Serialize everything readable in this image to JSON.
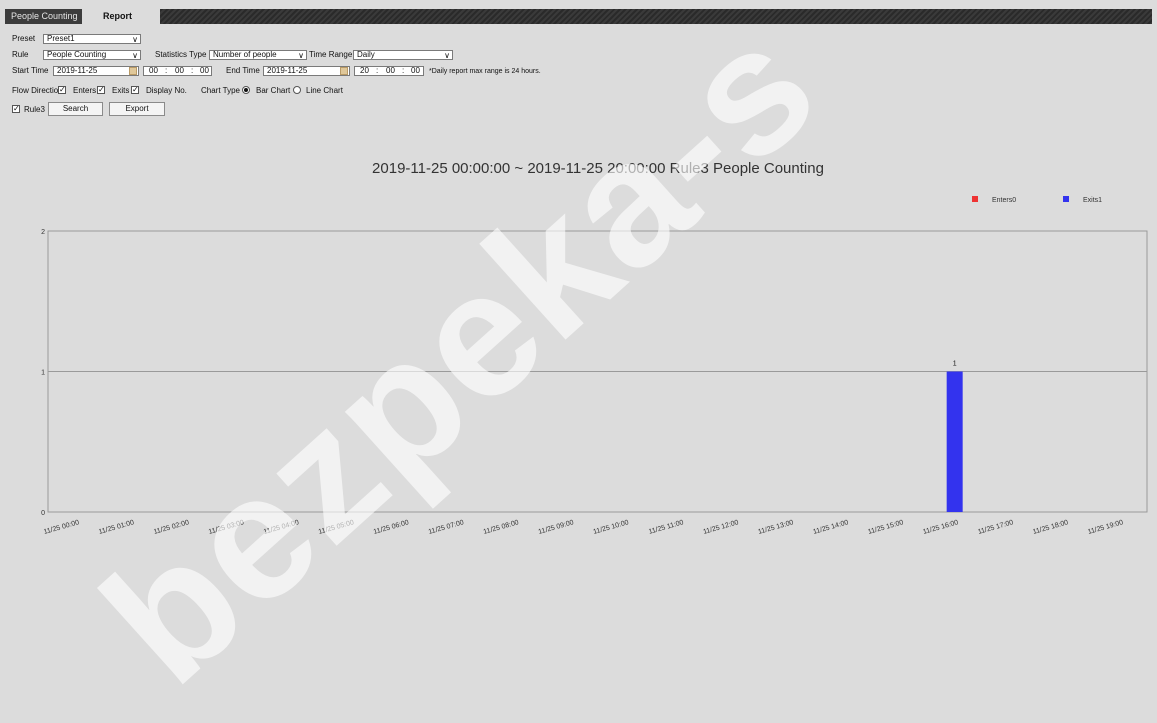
{
  "tabs": [
    {
      "label": "People Counting",
      "active": false
    },
    {
      "label": "Report",
      "active": true
    }
  ],
  "form": {
    "preset_label": "Preset",
    "preset_value": "Preset1",
    "rule_label": "Rule",
    "rule_value": "People Counting",
    "stats_type_label": "Statistics Type",
    "stats_type_value": "Number of people",
    "time_range_label": "Time Range",
    "time_range_value": "Daily",
    "start_time_label": "Start Time",
    "start_date": "2019-11-25",
    "start_hh": "00",
    "start_mm": "00",
    "start_ss": "00",
    "end_time_label": "End Time",
    "end_date": "2019-11-25",
    "end_hh": "20",
    "end_mm": "00",
    "end_ss": "00",
    "time_sep": ":",
    "range_note": "*Daily report max range is 24 hours.",
    "flow_direction_label": "Flow Direction",
    "enters_label": "Enters",
    "enters_checked": true,
    "exits_label": "Exits",
    "exits_checked": true,
    "display_no_label": "Display No.",
    "display_no_checked": true,
    "chart_type_label": "Chart Type",
    "bar_chart_label": "Bar Chart",
    "line_chart_label": "Line Chart",
    "selected_chart_type": "bar",
    "rule3_label": "Rule3",
    "rule3_checked": true,
    "search_button": "Search",
    "export_button": "Export"
  },
  "chart_data": {
    "type": "bar",
    "title": "2019-11-25 00:00:00 ~ 2019-11-25 20:00:00 Rule3 People Counting",
    "categories": [
      "11/25 00:00",
      "11/25 01:00",
      "11/25 02:00",
      "11/25 03:00",
      "11/25 04:00",
      "11/25 05:00",
      "11/25 06:00",
      "11/25 07:00",
      "11/25 08:00",
      "11/25 09:00",
      "11/25 10:00",
      "11/25 11:00",
      "11/25 12:00",
      "11/25 13:00",
      "11/25 14:00",
      "11/25 15:00",
      "11/25 16:00",
      "11/25 17:00",
      "11/25 18:00",
      "11/25 19:00"
    ],
    "series": [
      {
        "name": "Enters0",
        "color": "#ee3333",
        "values": [
          0,
          0,
          0,
          0,
          0,
          0,
          0,
          0,
          0,
          0,
          0,
          0,
          0,
          0,
          0,
          0,
          0,
          0,
          0,
          0
        ]
      },
      {
        "name": "Exits1",
        "color": "#3333ee",
        "values": [
          0,
          0,
          0,
          0,
          0,
          0,
          0,
          0,
          0,
          0,
          0,
          0,
          0,
          0,
          0,
          0,
          1,
          0,
          0,
          0
        ]
      }
    ],
    "ylim": [
      0,
      2
    ],
    "yticks": [
      0,
      1,
      2
    ],
    "grid": true,
    "show_value_labels": true,
    "legend_position": "top-right"
  },
  "watermark": "bezpeka-s",
  "colors": {
    "enters": "#ee3333",
    "exits": "#3333ee"
  }
}
